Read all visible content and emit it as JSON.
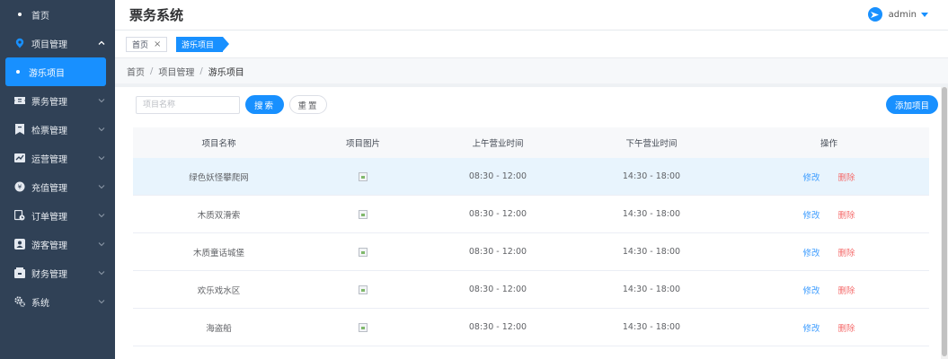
{
  "app": {
    "title": "票务系统"
  },
  "user": {
    "name": "admin"
  },
  "colors": {
    "sidebar_bg": "#304156",
    "accent": "#1890ff",
    "danger": "#f56c6c",
    "link": "#409eff"
  },
  "sidebar": {
    "items": [
      {
        "label": "首页",
        "icon": "dot-icon"
      },
      {
        "label": "项目管理",
        "icon": "pin-icon",
        "expanded": true
      },
      {
        "label": "票务管理",
        "icon": "ticket-icon"
      },
      {
        "label": "检票管理",
        "icon": "check-icon"
      },
      {
        "label": "运营管理",
        "icon": "ops-icon"
      },
      {
        "label": "充值管理",
        "icon": "coin-icon"
      },
      {
        "label": "订单管理",
        "icon": "order-icon"
      },
      {
        "label": "游客管理",
        "icon": "user-icon"
      },
      {
        "label": "财务管理",
        "icon": "wallet-icon"
      },
      {
        "label": "系统",
        "icon": "gear-icon"
      }
    ],
    "subitem": {
      "label": "游乐项目"
    }
  },
  "tags": {
    "home": "首页",
    "close": "×",
    "active": "游乐项目"
  },
  "breadcrumb": {
    "home": "首页",
    "parent": "项目管理",
    "current": "游乐项目",
    "sep": "/"
  },
  "toolbar": {
    "search_placeholder": "项目名称",
    "search_value": "",
    "search_label": "搜索",
    "reset_label": "重置",
    "add_label": "添加项目"
  },
  "table": {
    "columns": [
      "项目名称",
      "项目图片",
      "上午营业时间",
      "下午营业时间",
      "操作"
    ],
    "rows": [
      {
        "name": "绿色妖怪攀爬网",
        "am": "08:30 - 12:00",
        "pm": "14:30 - 18:00",
        "edit": "修改",
        "del": "删除"
      },
      {
        "name": "木质双滑索",
        "am": "08:30 - 12:00",
        "pm": "14:30 - 18:00",
        "edit": "修改",
        "del": "删除"
      },
      {
        "name": "木质童话城堡",
        "am": "08:30 - 12:00",
        "pm": "14:30 - 18:00",
        "edit": "修改",
        "del": "删除"
      },
      {
        "name": "欢乐戏水区",
        "am": "08:30 - 12:00",
        "pm": "14:30 - 18:00",
        "edit": "修改",
        "del": "删除"
      },
      {
        "name": "海盗船",
        "am": "08:30 - 12:00",
        "pm": "14:30 - 18:00",
        "edit": "修改",
        "del": "删除"
      }
    ]
  }
}
